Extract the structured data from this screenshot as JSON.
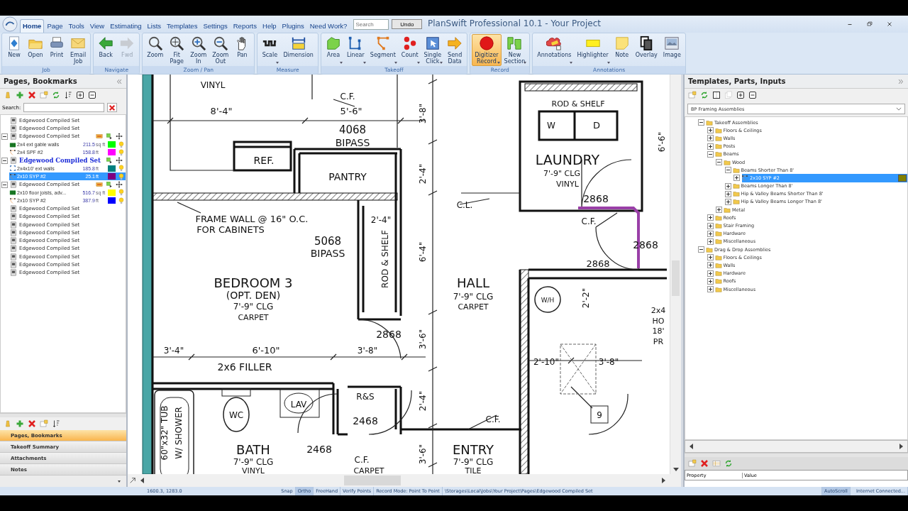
{
  "window": {
    "title": "PlanSwift Professional 10.1 - Your Project"
  },
  "menu_tabs": [
    {
      "label": "Home",
      "selected": true
    },
    {
      "label": "Page",
      "selected": false
    },
    {
      "label": "Tools",
      "selected": false
    },
    {
      "label": "View",
      "selected": false
    },
    {
      "label": "Estimating",
      "selected": false
    },
    {
      "label": "Lists",
      "selected": false
    },
    {
      "label": "Templates",
      "selected": false
    },
    {
      "label": "Settings",
      "selected": false
    },
    {
      "label": "Reports",
      "selected": false
    },
    {
      "label": "Help",
      "selected": false
    },
    {
      "label": "Plugins",
      "selected": false
    },
    {
      "label": "Need Work?",
      "selected": false
    }
  ],
  "search": {
    "placeholder": "Search"
  },
  "undo_button": "Undo",
  "ribbon": [
    {
      "group": "Job",
      "buttons": [
        {
          "label": "New",
          "dropdown": false,
          "disabled": false,
          "selected": false
        },
        {
          "label": "Open",
          "dropdown": false,
          "disabled": false,
          "selected": false
        },
        {
          "label": "Print",
          "dropdown": false,
          "disabled": false,
          "selected": false
        },
        {
          "label": "Email Job",
          "dropdown": false,
          "disabled": false,
          "selected": false
        }
      ]
    },
    {
      "group": "Navigate",
      "buttons": [
        {
          "label": "Back",
          "dropdown": false,
          "disabled": false,
          "selected": false
        },
        {
          "label": "Fwd",
          "dropdown": false,
          "disabled": true,
          "selected": false
        }
      ]
    },
    {
      "group": "Zoom / Pan",
      "buttons": [
        {
          "label": "Zoom",
          "dropdown": false,
          "disabled": false,
          "selected": false
        },
        {
          "label": "Fit Page",
          "dropdown": false,
          "disabled": false,
          "selected": false
        },
        {
          "label": "Zoom In",
          "dropdown": false,
          "disabled": false,
          "selected": false
        },
        {
          "label": "Zoom Out",
          "dropdown": false,
          "disabled": false,
          "selected": false
        },
        {
          "label": "Pan",
          "dropdown": false,
          "disabled": false,
          "selected": false
        }
      ]
    },
    {
      "group": "Measure",
      "buttons": [
        {
          "label": "Scale",
          "dropdown": true,
          "disabled": false,
          "selected": false
        },
        {
          "label": "Dimension",
          "dropdown": false,
          "disabled": false,
          "selected": false
        }
      ]
    },
    {
      "group": "Takeoff",
      "buttons": [
        {
          "label": "Area",
          "dropdown": true,
          "disabled": false,
          "selected": false
        },
        {
          "label": "Linear",
          "dropdown": true,
          "disabled": false,
          "selected": false
        },
        {
          "label": "Segment",
          "dropdown": true,
          "disabled": false,
          "selected": false
        },
        {
          "label": "Count",
          "dropdown": true,
          "disabled": false,
          "selected": false
        },
        {
          "label": "Single Click",
          "dropdown": true,
          "disabled": false,
          "selected": false
        },
        {
          "label": "Send Data",
          "dropdown": false,
          "disabled": false,
          "selected": false
        }
      ]
    },
    {
      "group": "Record",
      "buttons": [
        {
          "label": "Digitizer Record",
          "dropdown": true,
          "disabled": false,
          "selected": true
        },
        {
          "label": "New Section",
          "dropdown": true,
          "disabled": false,
          "selected": false
        }
      ]
    },
    {
      "group": "Annotations",
      "buttons": [
        {
          "label": "Annotations",
          "dropdown": true,
          "disabled": false,
          "selected": false
        },
        {
          "label": "Highlighter",
          "dropdown": true,
          "disabled": false,
          "selected": false
        },
        {
          "label": "Note",
          "dropdown": false,
          "disabled": false,
          "selected": false
        },
        {
          "label": "Overlay",
          "dropdown": false,
          "disabled": false,
          "selected": false
        },
        {
          "label": "Image",
          "dropdown": false,
          "disabled": false,
          "selected": false
        }
      ]
    }
  ],
  "left_panel": {
    "title": "Pages, Bookmarks",
    "search_label": "Search:",
    "pages": [
      {
        "name": "Edgewood Compiled Set",
        "current": false,
        "selected": false
      },
      {
        "name": "Edgewood Compiled Set",
        "current": false,
        "selected": false
      },
      {
        "name": "Edgewood Compiled Set",
        "current": false,
        "selected": false,
        "expanded": true,
        "items": [
          {
            "name": "2x4 ext gable walls",
            "value": "211.5",
            "unit": "sq ft",
            "color": "#00ff00",
            "kind": "area",
            "selected": false
          },
          {
            "name": "2x4 SPF #2",
            "value": "158.8",
            "unit": "ft",
            "color": "#ff00ff",
            "kind": "segment",
            "selected": false
          }
        ]
      },
      {
        "name": "Edgewood Compiled Set",
        "current": true,
        "selected": false,
        "expanded": true,
        "items": [
          {
            "name": "2x4x10' ext walls",
            "value": "185.8",
            "unit": "ft",
            "color": "#008080",
            "kind": "linear",
            "selected": false
          },
          {
            "name": "2x10 SYP #2",
            "value": "25.1",
            "unit": "ft",
            "color": "#800080",
            "kind": "segment",
            "selected": true
          }
        ]
      },
      {
        "name": "Edgewood Compiled Set",
        "current": false,
        "selected": false,
        "expanded": true,
        "items": [
          {
            "name": "2x10 floor joists, adv...",
            "value": "516.7",
            "unit": "sq ft",
            "color": "#ffff00",
            "kind": "area",
            "selected": false
          },
          {
            "name": "2x10 SYP #2",
            "value": "387.9",
            "unit": "ft",
            "color": "#0000ff",
            "kind": "segment",
            "selected": false
          }
        ]
      },
      {
        "name": "Edgewood Compiled Set",
        "current": false,
        "selected": false
      },
      {
        "name": "Edgewood Compiled Set",
        "current": false,
        "selected": false
      },
      {
        "name": "Edgewood Compiled Set",
        "current": false,
        "selected": false
      },
      {
        "name": "Edgewood Compiled Set",
        "current": false,
        "selected": false
      },
      {
        "name": "Edgewood Compiled Set",
        "current": false,
        "selected": false
      },
      {
        "name": "Edgewood Compiled Set",
        "current": false,
        "selected": false
      },
      {
        "name": "Edgewood Compiled Set",
        "current": false,
        "selected": false
      },
      {
        "name": "Edgewood Compiled Set",
        "current": false,
        "selected": false
      },
      {
        "name": "Edgewood Compiled Set",
        "current": false,
        "selected": false
      }
    ],
    "nav": [
      {
        "label": "Pages, Bookmarks",
        "selected": true
      },
      {
        "label": "Takeoff Summary",
        "selected": false
      },
      {
        "label": "Attachments",
        "selected": false
      },
      {
        "label": "Notes",
        "selected": false
      }
    ]
  },
  "blueprint": {
    "labels": [
      "VINYL",
      "C.F.",
      "8'-4\"",
      "5'-6\"",
      "4068",
      "BIPASS",
      "REF.",
      "PANTRY",
      "ROD & SHELF",
      "W",
      "D",
      "LAUNDRY",
      "7'-9\" CLG",
      "VINYL",
      "C.L.",
      "FRAME WALL @ 16\" O.C.",
      "FOR CABINETS",
      "2'-4\"",
      "5068",
      "BIPASS",
      "2868",
      "C.F.",
      "2868",
      "2868",
      "BEDROOM 3",
      "(OPT. DEN)",
      "7'-9\" CLG",
      "CARPET",
      "HALL",
      "7'-9\" CLG",
      "CARPET",
      "W/H",
      "2'-2\"",
      "2x4",
      "HO",
      "18'",
      "PR",
      "2868",
      "3'-4\"",
      "6'-10\"",
      "3'-8\"",
      "2'-10\"",
      "3'-8\"",
      "2x6 FILLER",
      "R&S",
      "LAV",
      "WC",
      "2468",
      "C.F.",
      "9",
      "BATH",
      "7'-9\" CLG",
      "VINYL",
      "2468",
      "C.F.",
      "CARPET",
      "ENTRY",
      "7'-9\" CLG",
      "TILE",
      "3'-8\"",
      "2'-4\"",
      "6'-4\"",
      "3'-6\"",
      "2'-4\"",
      "3'-6\"",
      "ROD & SHELF",
      "6'-6\"",
      "60\"x32\" TUB",
      "W/ SHOWER"
    ]
  },
  "right_panel": {
    "title": "Templates, Parts, Inputs",
    "dropdown": "BP Framing Assemblies",
    "tree": [
      {
        "label": "Takeoff Assemblies",
        "expanded": true,
        "children": [
          {
            "label": "Floors & Ceilings",
            "expanded": false
          },
          {
            "label": "Walls",
            "expanded": false
          },
          {
            "label": "Posts",
            "expanded": false
          },
          {
            "label": "Beams",
            "expanded": true,
            "children": [
              {
                "label": "Wood",
                "expanded": true,
                "children": [
                  {
                    "label": "Beams Shorter Than 8'",
                    "expanded": true,
                    "children": [
                      {
                        "label": "2x10 SYP #2",
                        "kind": "part",
                        "expanded": false,
                        "selected": true,
                        "color": "#808000"
                      }
                    ]
                  },
                  {
                    "label": "Beams Longer Than 8'",
                    "expanded": false
                  },
                  {
                    "label": "Hip & Valley Beams Shorter Than 8'",
                    "expanded": false
                  },
                  {
                    "label": "Hip & Valley Beams Longer Than 8'",
                    "expanded": false
                  }
                ]
              },
              {
                "label": "Metal",
                "expanded": false
              }
            ]
          },
          {
            "label": "Roofs",
            "expanded": false
          },
          {
            "label": "Stair Framing",
            "expanded": false
          },
          {
            "label": "Hardware",
            "expanded": false
          },
          {
            "label": "Miscellaneous",
            "expanded": false
          }
        ]
      },
      {
        "label": "Drag & Drop Assemblies",
        "expanded": true,
        "children": [
          {
            "label": "Floors & Ceilings",
            "expanded": false
          },
          {
            "label": "Walls",
            "expanded": false
          },
          {
            "label": "Hardware",
            "expanded": false
          },
          {
            "label": "Roofs",
            "expanded": false
          },
          {
            "label": "Miscellaneous",
            "expanded": false
          }
        ]
      }
    ],
    "property_columns": [
      "Property",
      "Value"
    ]
  },
  "status_bar": {
    "coordinates": "1600.3, 1283.0",
    "toggles": [
      {
        "label": "Snap",
        "on": false
      },
      {
        "label": "Ortho",
        "on": true
      },
      {
        "label": "FreeHand",
        "on": false
      },
      {
        "label": "Verify Points",
        "on": false
      }
    ],
    "record_mode": "Record Mode: Point To Point",
    "path": "\\Storages\\Local\\Jobs\\Your Project\\Pages\\Edgewood Compiled Set",
    "autoscroll": {
      "label": "AutoScroll",
      "on": true
    },
    "connection": "Internet Connected..."
  }
}
